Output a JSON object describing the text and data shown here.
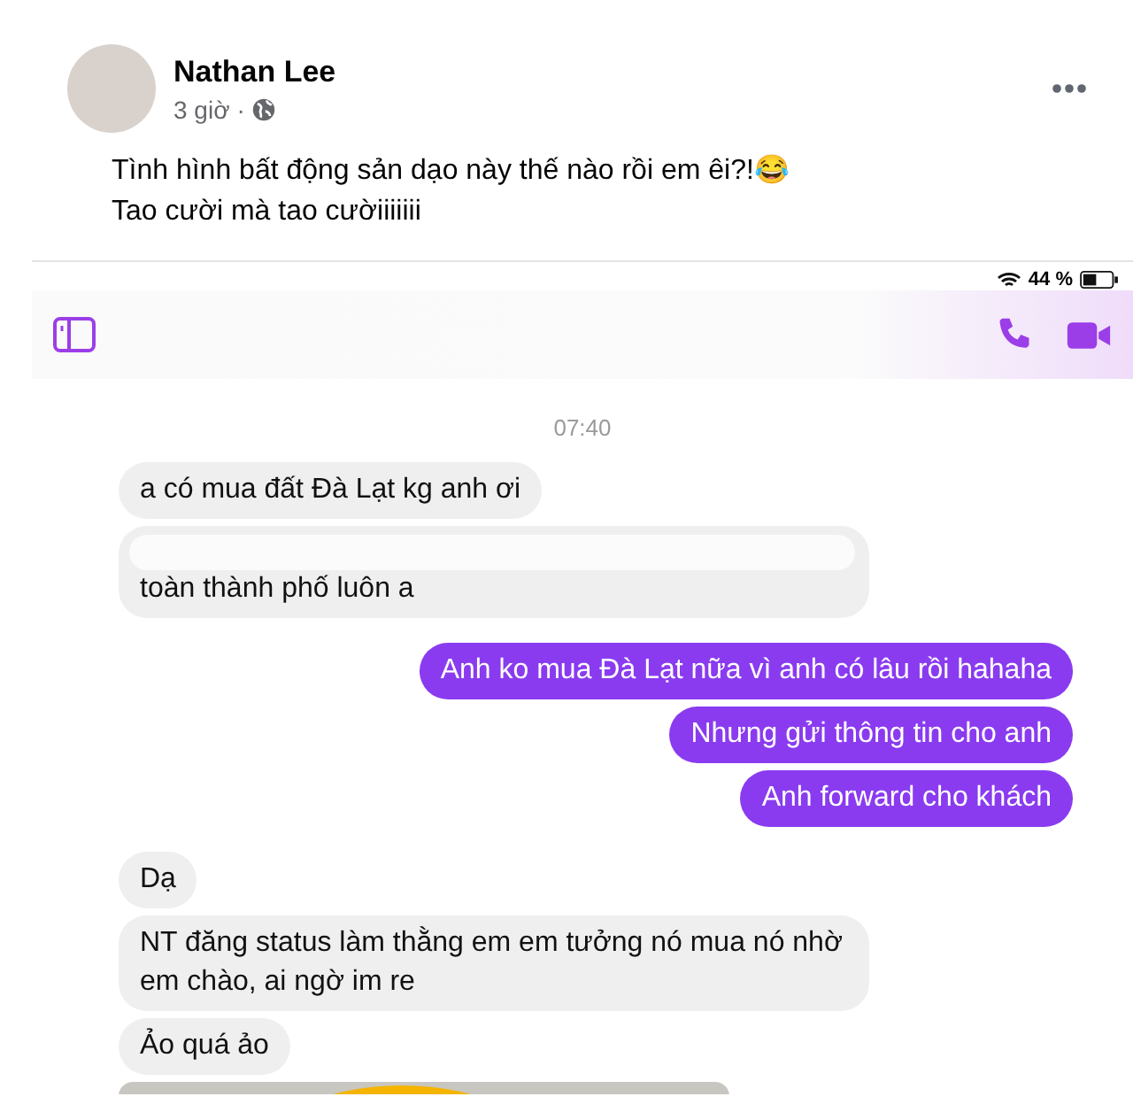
{
  "post": {
    "author": "Nathan Lee",
    "time": "3 giờ",
    "separator": "·",
    "lines": [
      "Tình hình bất động sản dạo này thế nào rồi em êi?!😂",
      "Tao cười mà tao cườiiiiiii"
    ]
  },
  "chat": {
    "status": {
      "battery_text": "44 %"
    },
    "timestamp": "07:40",
    "messages": [
      {
        "kind": "incoming",
        "text": "a có mua đất Đà Lạt kg anh ơi",
        "redacted": false
      },
      {
        "kind": "incoming",
        "text": "toàn thành phố luôn a",
        "redacted": true
      },
      {
        "kind": "outgoing",
        "text": "Anh ko mua Đà Lạt nữa vì anh có lâu rồi hahaha",
        "redacted": false
      },
      {
        "kind": "outgoing",
        "text": "Nhưng gửi thông tin cho anh",
        "redacted": false
      },
      {
        "kind": "outgoing",
        "text": "Anh forward cho khách",
        "redacted": false
      },
      {
        "kind": "incoming",
        "text": "Dạ",
        "redacted": false
      },
      {
        "kind": "incoming",
        "text": "NT đăng status làm thằng em em tưởng nó mua nó nhờ em chào, ai ngờ im re",
        "redacted": false
      },
      {
        "kind": "incoming",
        "text": "Ảo quá ảo",
        "redacted": false
      }
    ]
  }
}
